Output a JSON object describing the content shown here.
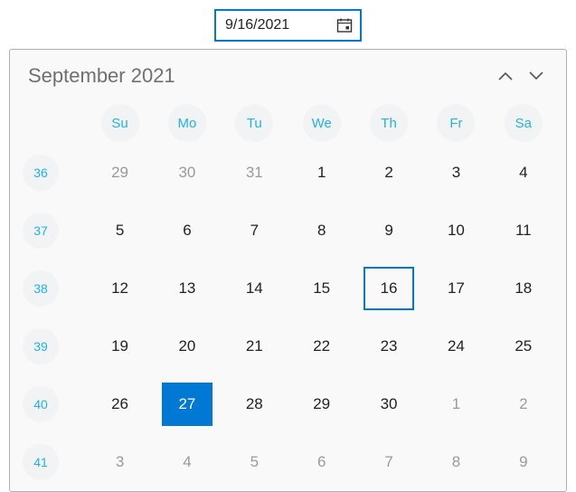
{
  "input": {
    "value": "9/16/2021",
    "icon": "calendar-icon"
  },
  "calendar": {
    "title": "September 2021",
    "nav": {
      "prev_icon": "chevron-up-icon",
      "next_icon": "chevron-down-icon"
    },
    "day_headers": [
      "Su",
      "Mo",
      "Tu",
      "We",
      "Th",
      "Fr",
      "Sa"
    ],
    "weeks": [
      {
        "num": "36",
        "days": [
          {
            "d": "29",
            "out": true
          },
          {
            "d": "30",
            "out": true
          },
          {
            "d": "31",
            "out": true
          },
          {
            "d": "1"
          },
          {
            "d": "2"
          },
          {
            "d": "3"
          },
          {
            "d": "4"
          }
        ]
      },
      {
        "num": "37",
        "days": [
          {
            "d": "5"
          },
          {
            "d": "6"
          },
          {
            "d": "7"
          },
          {
            "d": "8"
          },
          {
            "d": "9"
          },
          {
            "d": "10"
          },
          {
            "d": "11"
          }
        ]
      },
      {
        "num": "38",
        "days": [
          {
            "d": "12"
          },
          {
            "d": "13"
          },
          {
            "d": "14"
          },
          {
            "d": "15"
          },
          {
            "d": "16",
            "selected": true
          },
          {
            "d": "17"
          },
          {
            "d": "18"
          }
        ]
      },
      {
        "num": "39",
        "days": [
          {
            "d": "19"
          },
          {
            "d": "20"
          },
          {
            "d": "21"
          },
          {
            "d": "22"
          },
          {
            "d": "23"
          },
          {
            "d": "24"
          },
          {
            "d": "25"
          }
        ]
      },
      {
        "num": "40",
        "days": [
          {
            "d": "26"
          },
          {
            "d": "27",
            "today": true
          },
          {
            "d": "28"
          },
          {
            "d": "29"
          },
          {
            "d": "30"
          },
          {
            "d": "1",
            "out": true
          },
          {
            "d": "2",
            "out": true
          }
        ]
      },
      {
        "num": "41",
        "days": [
          {
            "d": "3",
            "out": true
          },
          {
            "d": "4",
            "out": true
          },
          {
            "d": "5",
            "out": true
          },
          {
            "d": "6",
            "out": true
          },
          {
            "d": "7",
            "out": true
          },
          {
            "d": "8",
            "out": true
          },
          {
            "d": "9",
            "out": true
          }
        ]
      }
    ]
  },
  "colors": {
    "accent": "#0078d4",
    "cyan": "#21b3e8"
  }
}
